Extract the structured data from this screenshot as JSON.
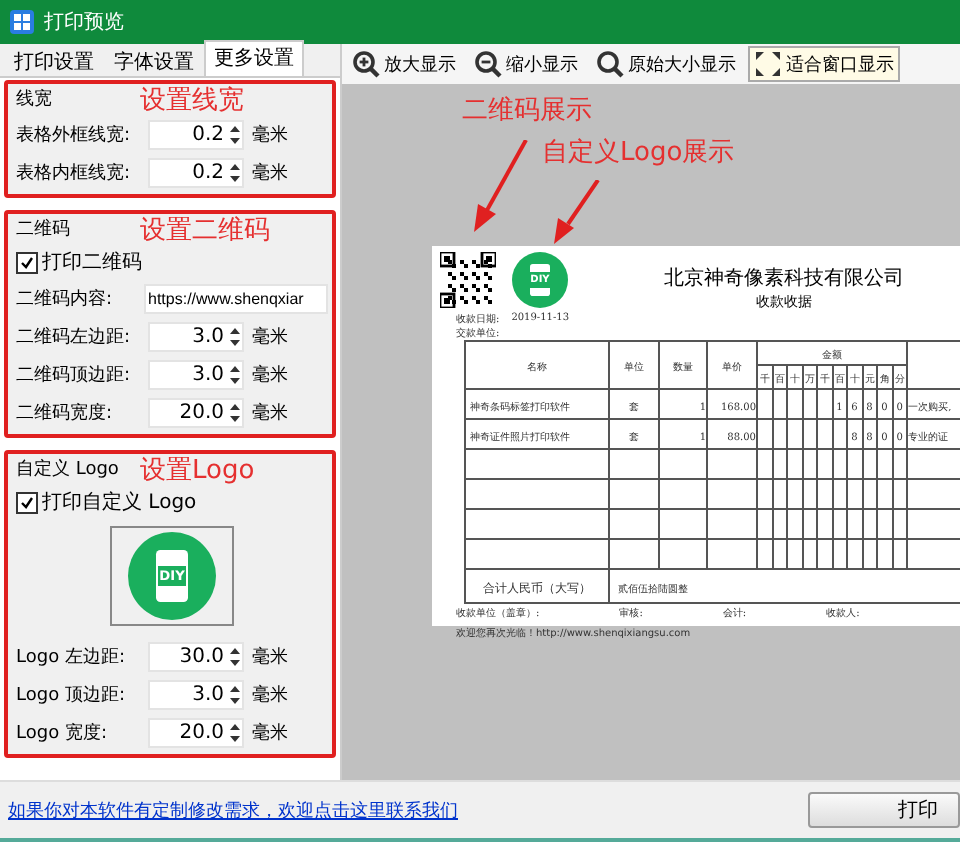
{
  "window": {
    "title": "打印预览"
  },
  "tabs": [
    {
      "label": "打印设置",
      "selected": false
    },
    {
      "label": "字体设置",
      "selected": false
    },
    {
      "label": "更多设置",
      "selected": true
    }
  ],
  "groups": [
    {
      "title": "线宽",
      "annotation": "设置线宽",
      "fields": [
        {
          "kind": "spin",
          "label": "表格外框线宽:",
          "value": "0.2",
          "unit": "毫米"
        },
        {
          "kind": "spin",
          "label": "表格内框线宽:",
          "value": "0.2",
          "unit": "毫米"
        }
      ]
    },
    {
      "title": "二维码",
      "annotation": "设置二维码",
      "print": {
        "label": "打印二维码",
        "checked": true
      },
      "fields": [
        {
          "kind": "text",
          "label": "二维码内容:",
          "value": "https://www.shenqxiar"
        },
        {
          "kind": "spin",
          "label": "二维码左边距:",
          "value": "3.0",
          "unit": "毫米"
        },
        {
          "kind": "spin",
          "label": "二维码顶边距:",
          "value": "3.0",
          "unit": "毫米"
        },
        {
          "kind": "spin",
          "label": "二维码宽度:",
          "value": "20.0",
          "unit": "毫米"
        }
      ]
    },
    {
      "title": "自定义 Logo",
      "annotation": "设置Logo",
      "print": {
        "label": "打印自定义 Logo",
        "checked": true
      },
      "logo_preview": {
        "text": "DIY"
      },
      "fields": [
        {
          "kind": "spin",
          "label": "Logo 左边距:",
          "value": "30.0",
          "unit": "毫米"
        },
        {
          "kind": "spin",
          "label": "Logo 顶边距:",
          "value": "3.0",
          "unit": "毫米"
        },
        {
          "kind": "spin",
          "label": "Logo 宽度:",
          "value": "20.0",
          "unit": "毫米"
        }
      ]
    }
  ],
  "toolbar": [
    {
      "label": "放大显示",
      "selected": false
    },
    {
      "label": "缩小显示",
      "selected": false
    },
    {
      "label": "原始大小显示",
      "selected": false
    },
    {
      "label": "适合窗口显示",
      "selected": true
    }
  ],
  "preview_annotations": [
    "二维码展示",
    "自定义Logo展示"
  ],
  "receipt": {
    "logo_text": "DIY",
    "company": "北京神奇像素科技有限公司",
    "title": "收款收据",
    "date_label": "收款日期:",
    "date": "2019-11-13",
    "payer_label": "交款单位:",
    "columns": [
      "名称",
      "单位",
      "数量",
      "单价"
    ],
    "amount_label": "金额",
    "digits": [
      "千",
      "百",
      "十",
      "万",
      "千",
      "百",
      "十",
      "元",
      "角",
      "分"
    ],
    "rows": [
      {
        "name": "神奇条码标签打印软件",
        "unit": "套",
        "qty": "1",
        "price": "168.00",
        "amount": [
          "1",
          "6",
          "8",
          "0",
          "0"
        ],
        "remark": "一次购买,"
      },
      {
        "name": "神奇证件照片打印软件",
        "unit": "套",
        "qty": "1",
        "price": "88.00",
        "amount": [
          "8",
          "8",
          "0",
          "0"
        ],
        "remark": "专业的证"
      }
    ],
    "total_label": "合计人民币（大写）",
    "total": "贰佰伍拾陆圆整",
    "signatures": [
      "收款单位（盖章）:",
      "审核:",
      "会计:",
      "收款人:"
    ],
    "footer": "欢迎您再次光临！http://www.shenqixiangsu.com"
  },
  "footer": {
    "link": "如果你对本软件有定制修改需求，欢迎点击这里联系我们",
    "print_button": "打印"
  }
}
